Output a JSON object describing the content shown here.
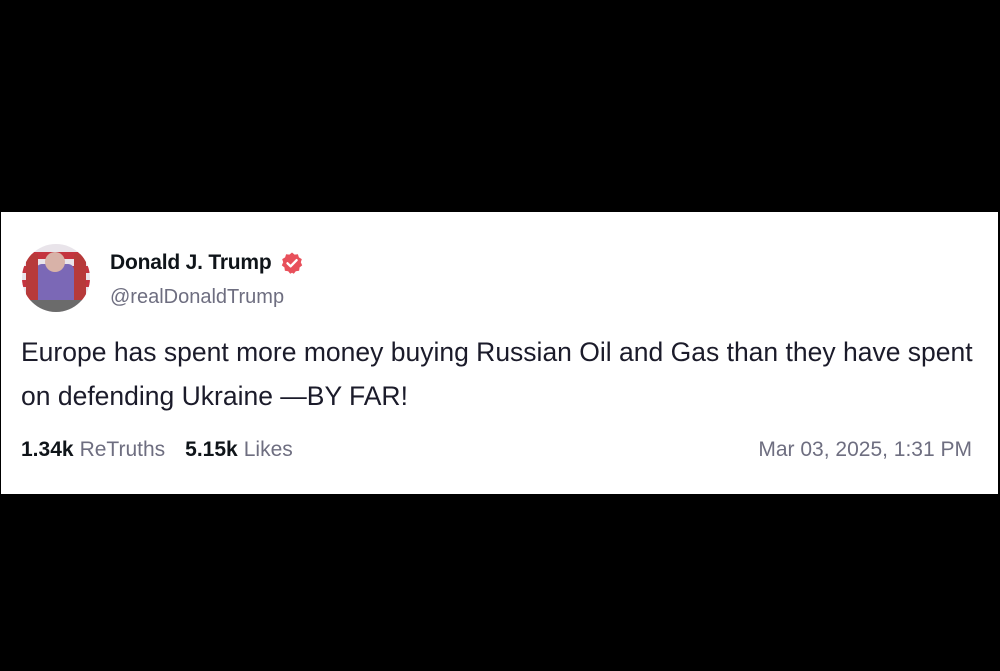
{
  "post": {
    "author_name": "Donald J. Trump",
    "author_handle": "@realDonaldTrump",
    "verified_icon": "verified-badge-icon",
    "avatar_icon": "profile-avatar",
    "text": "Europe has spent more money buying Russian Oil and Gas than they have spent on defending Ukraine —BY FAR!",
    "retruths_count": "1.34k",
    "retruths_label": "ReTruths",
    "likes_count": "5.15k",
    "likes_label": "Likes",
    "timestamp": "Mar 03, 2025, 1:31 PM"
  },
  "colors": {
    "background": "#000000",
    "card": "#ffffff",
    "verified": "#e8505b",
    "muted_text": "#6e6e80"
  }
}
